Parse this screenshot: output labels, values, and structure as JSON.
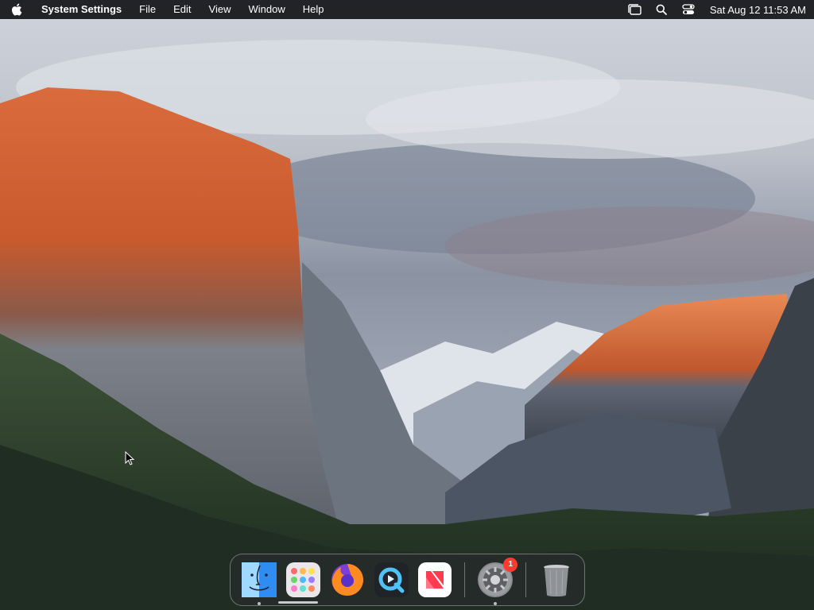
{
  "menubar": {
    "app_name": "System Settings",
    "menus": [
      "File",
      "Edit",
      "View",
      "Window",
      "Help"
    ],
    "status_icons": [
      "stage-manager-icon",
      "search-icon",
      "control-center-icon"
    ],
    "clock": "Sat Aug 12  11:53 AM"
  },
  "dock": {
    "items": [
      {
        "name": "Finder",
        "icon": "finder-icon",
        "running": true
      },
      {
        "name": "Launchpad",
        "icon": "launchpad-icon",
        "running": false
      },
      {
        "name": "Firefox",
        "icon": "firefox-icon",
        "running": false
      },
      {
        "name": "QuickTime Player",
        "icon": "quicktime-icon",
        "running": false
      },
      {
        "name": "News",
        "icon": "news-icon",
        "running": false
      },
      {
        "name": "System Settings",
        "icon": "settings-icon",
        "running": true,
        "badge": "1"
      },
      {
        "name": "Trash",
        "icon": "trash-icon",
        "running": false
      }
    ]
  },
  "colors": {
    "menubar_bg": "#141418",
    "badge": "#ff3b30",
    "accent_blue": "#1e7fe0"
  }
}
